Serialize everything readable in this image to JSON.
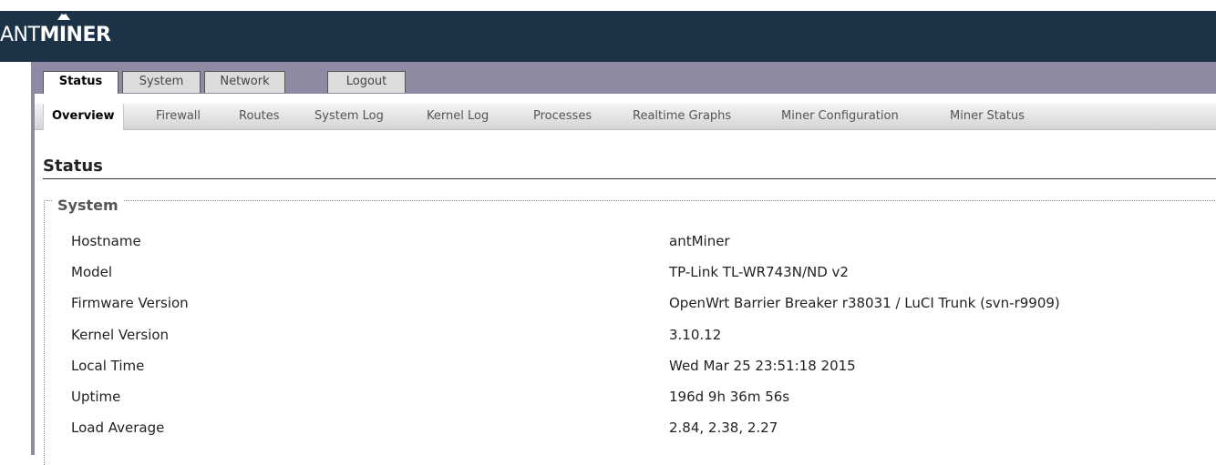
{
  "brand": {
    "ant": "ANT",
    "miner": "MINER"
  },
  "tabs": [
    {
      "label": "Status",
      "active": true
    },
    {
      "label": "System",
      "active": false
    },
    {
      "label": "Network",
      "active": false
    },
    {
      "label": "Logout",
      "active": false
    }
  ],
  "subnav": [
    {
      "label": "Overview",
      "active": true
    },
    {
      "label": "Firewall"
    },
    {
      "label": "Routes"
    },
    {
      "label": "System Log"
    },
    {
      "label": "Kernel Log"
    },
    {
      "label": "Processes"
    },
    {
      "label": "Realtime Graphs"
    },
    {
      "label": "Miner Configuration"
    },
    {
      "label": "Miner Status"
    }
  ],
  "page": {
    "title": "Status"
  },
  "system": {
    "legend": "System",
    "rows": [
      {
        "label": "Hostname",
        "value": "antMiner"
      },
      {
        "label": "Model",
        "value": "TP-Link TL-WR743N/ND v2"
      },
      {
        "label": "Firmware Version",
        "value": "OpenWrt Barrier Breaker r38031 / LuCI Trunk (svn-r9909)"
      },
      {
        "label": "Kernel Version",
        "value": "3.10.12"
      },
      {
        "label": "Local Time",
        "value": "Wed Mar 25 23:51:18 2015"
      },
      {
        "label": "Uptime",
        "value": "196d 9h 36m 56s"
      },
      {
        "label": "Load Average",
        "value": "2.84, 2.38, 2.27"
      }
    ]
  },
  "colors": {
    "header": "#1c3347",
    "band": "#8e8aa4"
  }
}
